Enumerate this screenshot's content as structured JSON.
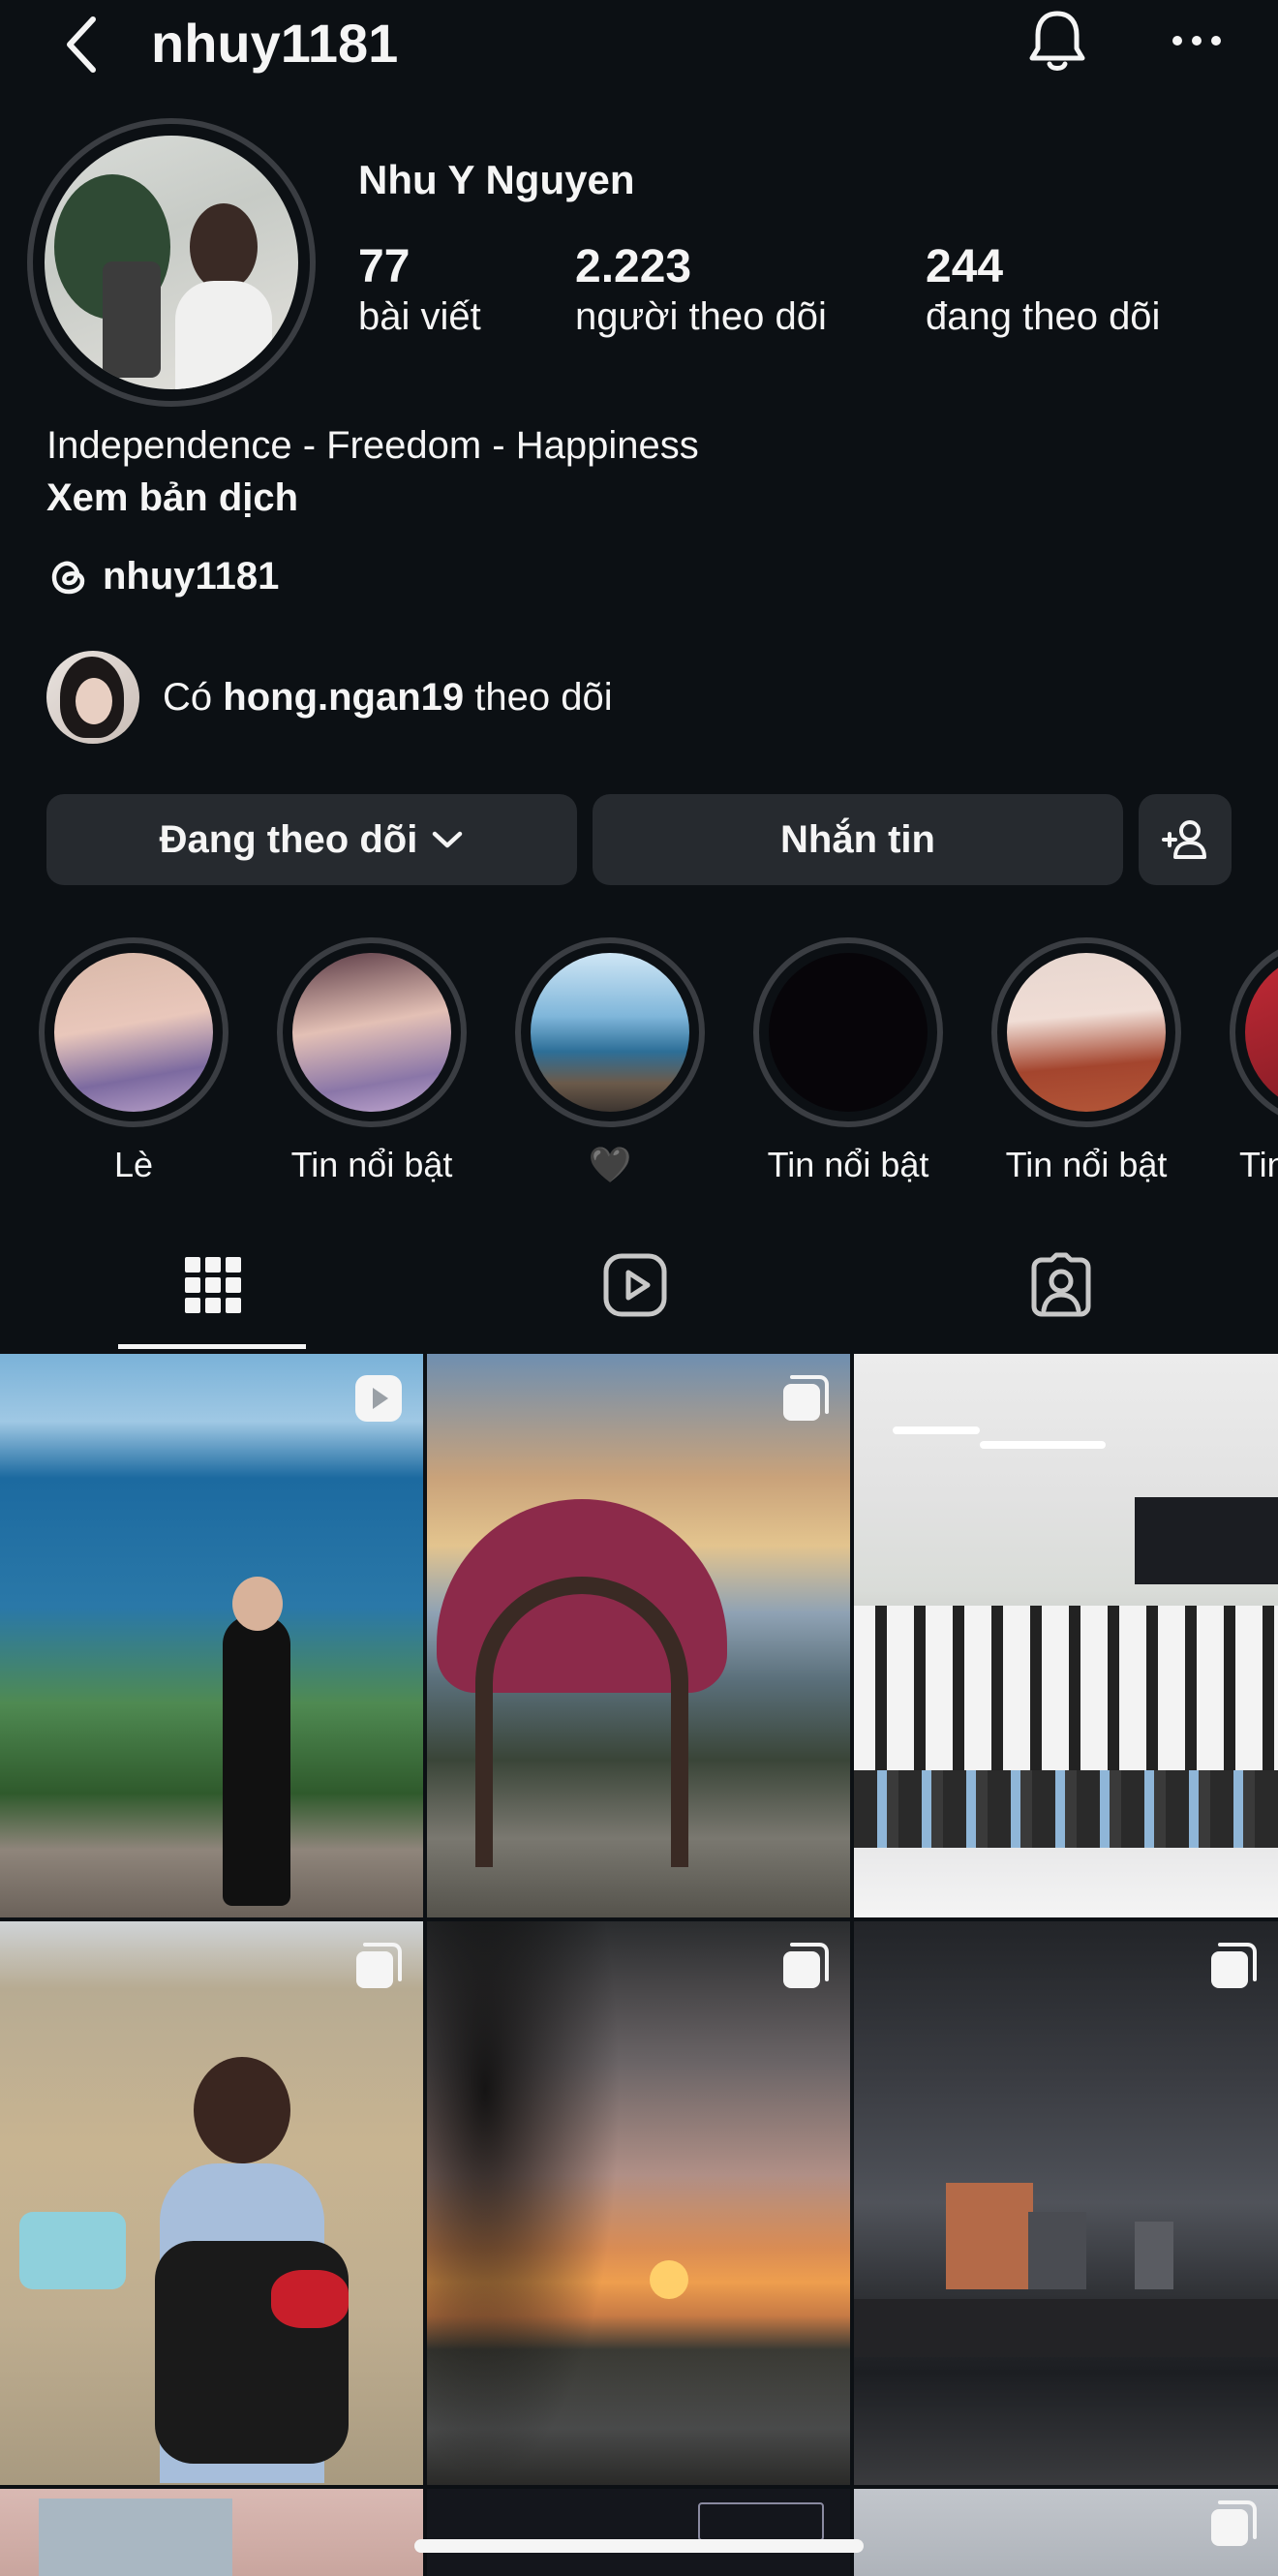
{
  "header": {
    "username": "nhuy1181"
  },
  "icons": {
    "back": "chevron-left-icon",
    "bell": "bell-icon",
    "more": "more-horizontal-icon",
    "threads": "threads-icon",
    "grid": "grid-icon",
    "reels": "reels-icon",
    "tagged": "tagged-icon",
    "add_person": "add-person-icon",
    "chevron": "chevron-down-icon",
    "carousel": "carousel-icon",
    "reel_badge": "play-icon"
  },
  "profile": {
    "display_name": "Nhu Y Nguyen",
    "stats": [
      {
        "value": "77",
        "label": "bài viết"
      },
      {
        "value": "2.223",
        "label": "người theo dõi"
      },
      {
        "value": "244",
        "label": "đang theo dõi"
      }
    ],
    "bio": "Independence - Freedom - Happiness",
    "translate": "Xem bản dịch",
    "threads_handle": "nhuy1181",
    "followed_by": {
      "prefix": "Có",
      "user": "hong.ngan19",
      "suffix": "theo dõi"
    }
  },
  "actions": {
    "following": "Đang theo dõi",
    "message": "Nhắn tin"
  },
  "highlights": [
    {
      "label": "Lè"
    },
    {
      "label": "Tin nổi bật"
    },
    {
      "label": "🖤"
    },
    {
      "label": "Tin nổi bật"
    },
    {
      "label": "Tin nổi bật"
    },
    {
      "label": "Tin"
    }
  ],
  "colors": {
    "background": "#0c1014",
    "button": "#262a2f",
    "text": "#f5f5f5",
    "ring": "#3a3d42"
  }
}
